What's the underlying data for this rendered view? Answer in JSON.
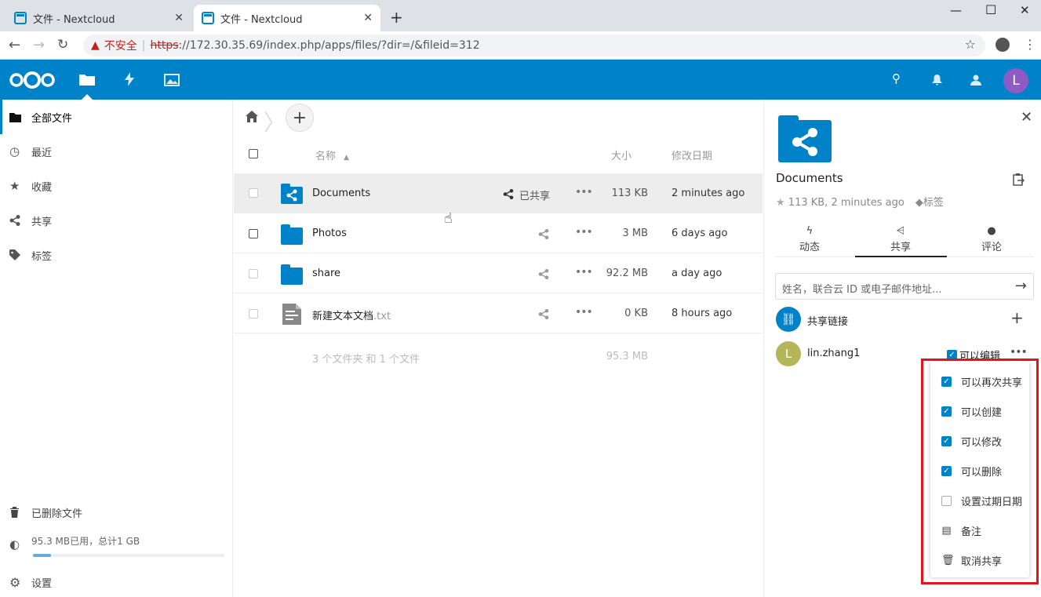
{
  "browser": {
    "tabs": [
      {
        "title": "文件 - Nextcloud",
        "active": false
      },
      {
        "title": "文件 - Nextcloud",
        "active": true
      }
    ],
    "security_label": "不安全",
    "url_scheme": "https",
    "url_rest": "://172.30.35.69/index.php/apps/files/?dir=/&fileid=312"
  },
  "header": {
    "avatar_letter": "L",
    "brand_color": "#0082c9"
  },
  "leftnav": {
    "items": [
      {
        "label": "全部文件",
        "icon": "folder-icon"
      },
      {
        "label": "最近",
        "icon": "clock-icon"
      },
      {
        "label": "收藏",
        "icon": "star-icon"
      },
      {
        "label": "共享",
        "icon": "share-icon"
      },
      {
        "label": "标签",
        "icon": "tag-icon"
      }
    ],
    "trash_label": "已删除文件",
    "quota_label": "95.3 MB已用，总计1 GB",
    "quota_fraction": 0.093,
    "settings_label": "设置"
  },
  "files": {
    "col_name": "名称",
    "col_size": "大小",
    "col_modified": "修改日期",
    "rows": [
      {
        "name": "Documents",
        "ext": "",
        "shared_label": "已共享",
        "size": "113 KB",
        "modified": "2 minutes ago"
      },
      {
        "name": "Photos",
        "ext": "",
        "shared_label": "",
        "size": "3 MB",
        "modified": "6 days ago"
      },
      {
        "name": "share",
        "ext": "",
        "shared_label": "",
        "size": "92.2 MB",
        "modified": "a day ago"
      },
      {
        "name": "新建文本文档",
        "ext": ".txt",
        "shared_label": "",
        "size": "0 KB",
        "modified": "8 hours ago"
      }
    ],
    "summary_text": "3 个文件夹 和 1 个文件",
    "summary_size": "95.3 MB"
  },
  "sidebar": {
    "title": "Documents",
    "meta": "113 KB, 2 minutes ago",
    "tags_label": "标签",
    "tabs": [
      "动态",
      "共享",
      "评论"
    ],
    "share_placeholder": "姓名，联合云 ID 或电子邮件地址...",
    "share_link_label": "共享链接",
    "share_user": "lin.zhang1",
    "share_user_letter": "L",
    "can_edit_label": "可以编辑",
    "menu": [
      {
        "label": "可以再次共享",
        "type": "checkbox",
        "checked": true
      },
      {
        "label": "可以创建",
        "type": "checkbox",
        "checked": true
      },
      {
        "label": "可以修改",
        "type": "checkbox",
        "checked": true
      },
      {
        "label": "可以删除",
        "type": "checkbox",
        "checked": true
      },
      {
        "label": "设置过期日期",
        "type": "checkbox",
        "checked": false
      },
      {
        "label": "备注",
        "type": "icon",
        "icon": "note-icon"
      },
      {
        "label": "取消共享",
        "type": "icon",
        "icon": "trash-icon"
      }
    ]
  }
}
